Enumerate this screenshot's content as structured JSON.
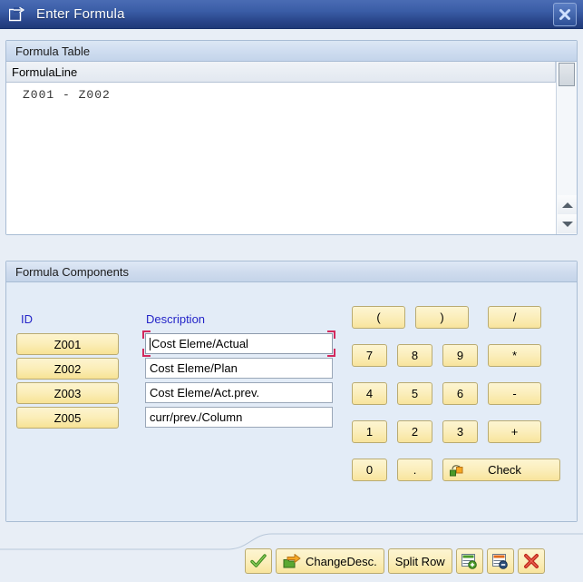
{
  "window": {
    "title": "Enter Formula",
    "title_icon": "enter-formula-icon",
    "close_icon": "close-icon"
  },
  "formula_table": {
    "header": "Formula Table",
    "column_header": "FormulaLine",
    "lines": [
      "Z001 - Z002"
    ],
    "scroll_up_icon": "scroll-up-icon",
    "scroll_down_icon": "scroll-down-icon"
  },
  "formula_components": {
    "header": "Formula Components",
    "columns": {
      "id": "ID",
      "description": "Description"
    },
    "rows": [
      {
        "id": "Z001",
        "description": "Cost Eleme/Actual",
        "focused": true
      },
      {
        "id": "Z002",
        "description": "Cost Eleme/Plan",
        "focused": false
      },
      {
        "id": "Z003",
        "description": "Cost Eleme/Act.prev.",
        "focused": false
      },
      {
        "id": "Z005",
        "description": "curr/prev./Column",
        "focused": false
      }
    ]
  },
  "keypad": {
    "open_paren": "(",
    "close_paren": ")",
    "divide": "/",
    "k7": "7",
    "k8": "8",
    "k9": "9",
    "multiply": "*",
    "k4": "4",
    "k5": "5",
    "k6": "6",
    "minus": "-",
    "k1": "1",
    "k2": "2",
    "k3": "3",
    "plus": "+",
    "k0": "0",
    "dot": ".",
    "check": "Check",
    "check_icon": "check-syntax-icon"
  },
  "toolbar": {
    "confirm_label": "",
    "confirm_icon": "green-check-icon",
    "change_desc": "ChangeDesc.",
    "change_desc_icon": "change-description-icon",
    "split_row": "Split Row",
    "insert_row_icon": "insert-row-icon",
    "delete_row_icon": "delete-row-icon",
    "cancel_icon": "red-x-icon"
  },
  "colors": {
    "titlebar_from": "#4a6cb4",
    "titlebar_to": "#1f3a79",
    "window_bg": "#e8eef6",
    "button_yellow": "#fbeeb8",
    "label_blue": "#2424c8",
    "focus_red": "#d2295c"
  }
}
